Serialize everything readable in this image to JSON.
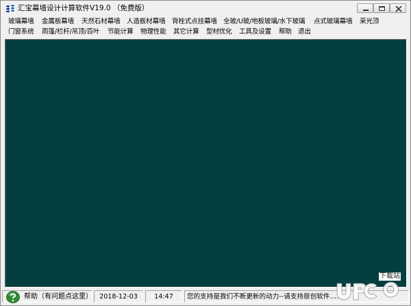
{
  "window": {
    "title": "汇宝幕墙设计计算软件V19.0 （免费版）"
  },
  "menu": {
    "row1": [
      "玻璃幕墙",
      "金属板幕墙",
      "天然石材幕墙",
      "人造板材幕墙",
      "背栓式点挂幕墙",
      "全玻/U玻/地板玻璃/水下玻璃",
      "点式玻璃幕墙",
      "采光顶"
    ],
    "row2": [
      "门窗系统",
      "雨篷/栏杆/吊顶/百叶",
      "节能计算",
      "物理性能",
      "其它计算",
      "型材优化",
      "工具及设置",
      "帮助",
      "退出"
    ]
  },
  "status": {
    "help_label": "帮助（有问题点这里）",
    "date": "2018-12-03",
    "time": "14:47",
    "message": "您的支持是我们不断更新的动力--请支持原创软件……"
  },
  "watermark": {
    "text": "下载站"
  },
  "colors": {
    "canvas": "#023f3e",
    "chrome": "#f0f0f0",
    "help_icon": "#2e8b2e"
  },
  "icons": {
    "app": "app-logo-icon",
    "minimize": "minimize-icon",
    "maximize": "maximize-icon",
    "close": "close-icon",
    "help": "question-mark-icon"
  }
}
